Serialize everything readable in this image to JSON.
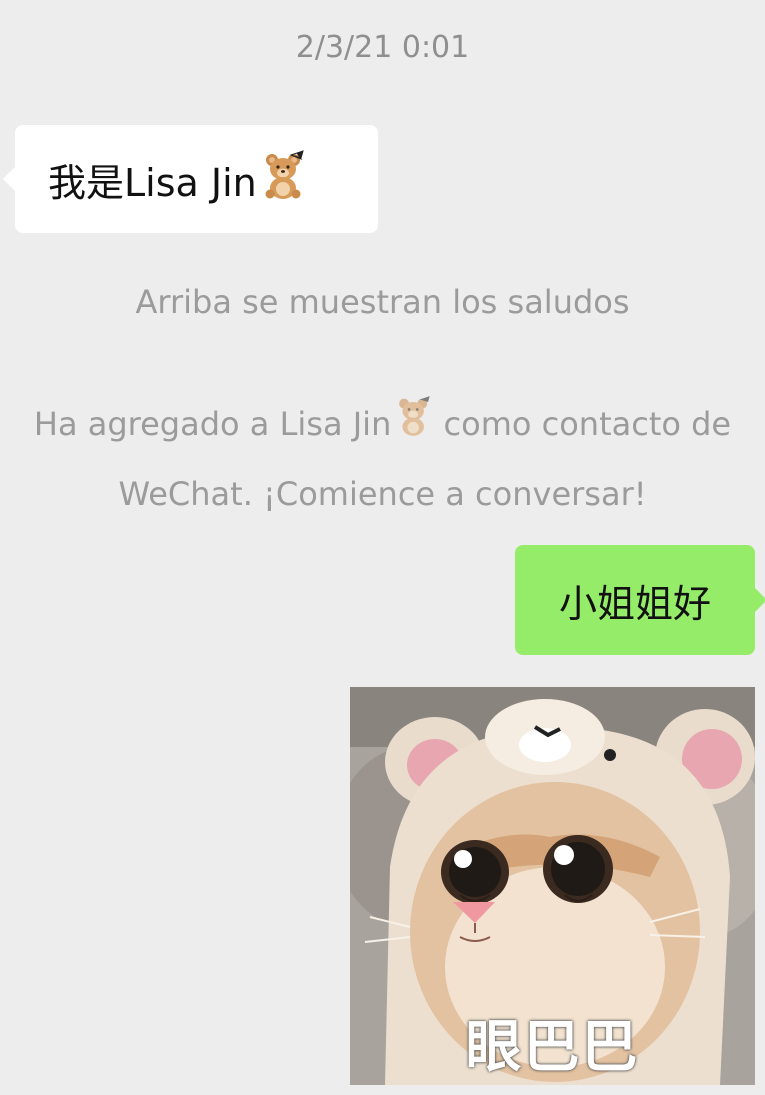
{
  "chat": {
    "timestamp": "2/3/21 0:01",
    "incoming_message": {
      "text": "我是Lisa Jin",
      "emoji": "teddy-bear-icon"
    },
    "system_messages": {
      "greetings_notice": "Arriba se muestran los saludos",
      "contact_added_prefix": "Ha agregado a Lisa Jin",
      "contact_added_line1_suffix": " como contacto de",
      "contact_added_line2": "WeChat. ¡Comience a conversar!"
    },
    "outgoing_message": {
      "text": "小姐姐好"
    },
    "sticker": {
      "caption": "眼巴巴"
    }
  },
  "colors": {
    "background": "#ededed",
    "incoming_bubble": "#ffffff",
    "outgoing_bubble": "#95ec69",
    "system_text": "#9b9b9b",
    "timestamp_text": "#8f8f8f"
  }
}
